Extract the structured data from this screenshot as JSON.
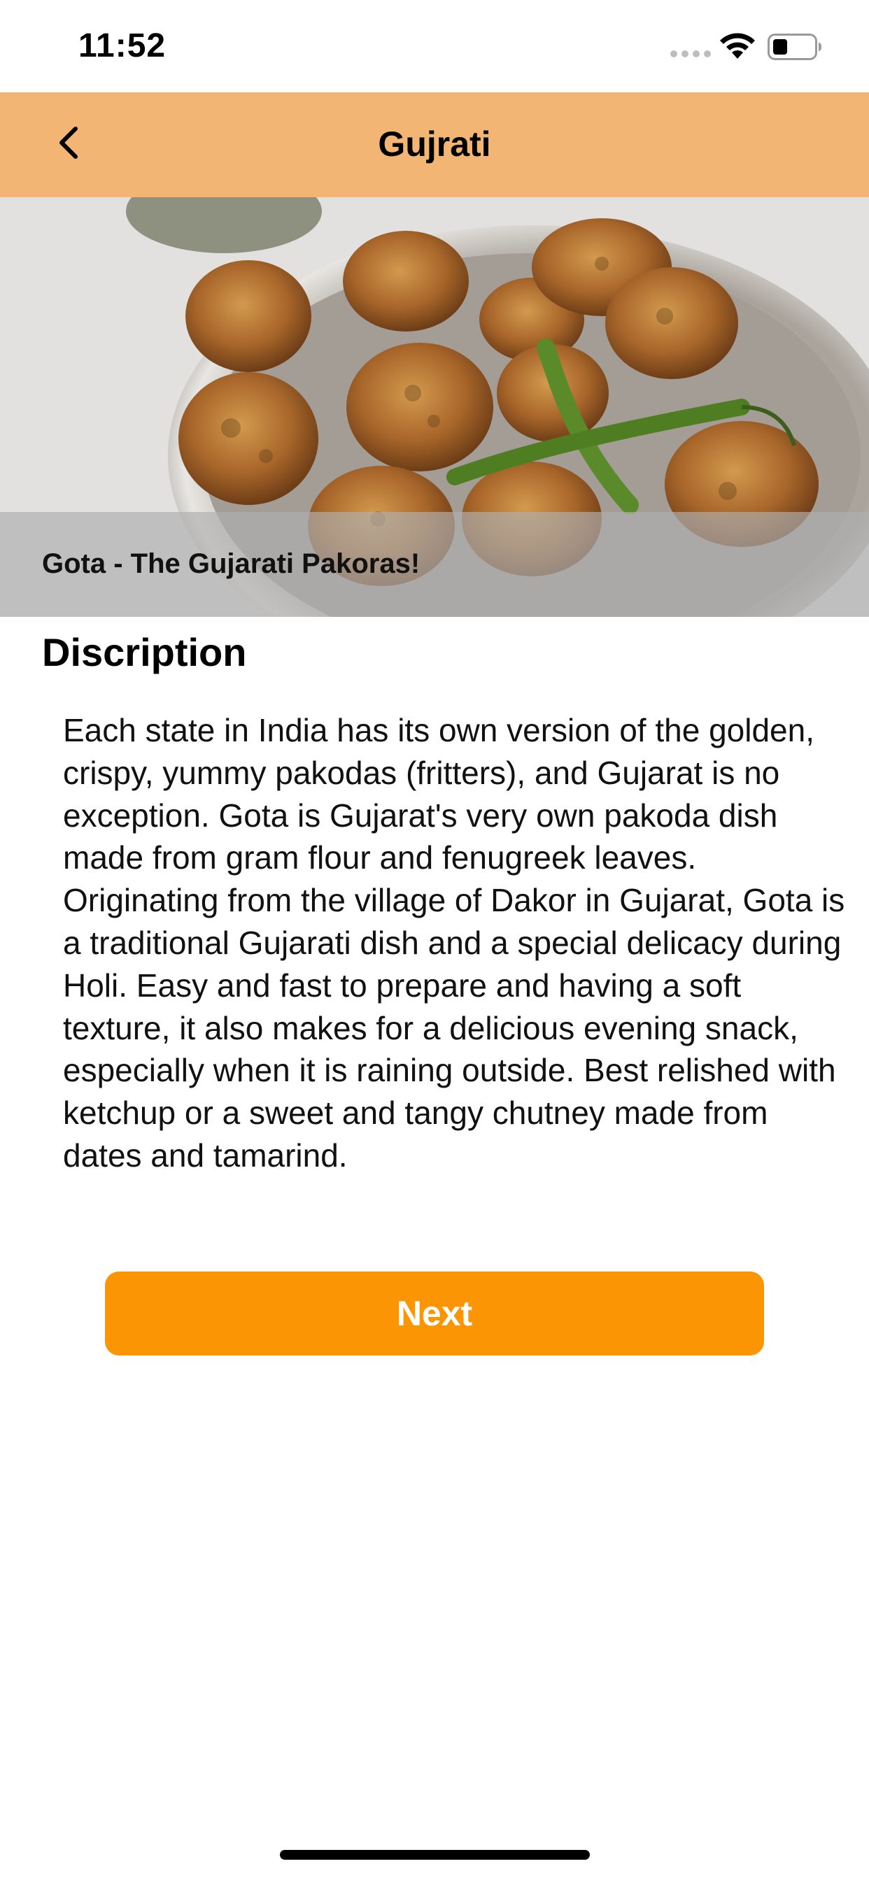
{
  "status_bar": {
    "time": "11:52",
    "icons": [
      "signal-dots-icon",
      "wifi-icon",
      "battery-icon"
    ]
  },
  "nav": {
    "back_icon": "chevron-left-icon",
    "title": "Gujrati"
  },
  "hero": {
    "caption": "Gota - The Gujarati Pakoras!"
  },
  "content": {
    "section_title": "Discription",
    "description": "Each state in India has its own version of the golden, crispy, yummy pakodas (fritters), and Gujarat is no exception. Gota is Gujarat's very own pakoda dish made from gram flour and fenugreek leaves. Originating from the village of Dakor in Gujarat, Gota is a traditional Gujarati dish and a special delicacy during Holi. Easy and fast to prepare and having a soft texture, it also makes for a delicious evening snack, especially when it is raining outside. Best relished with ketchup or a sweet and tangy chutney made from dates and tamarind."
  },
  "actions": {
    "next_label": "Next"
  },
  "colors": {
    "nav_background": "#f2b573",
    "button_background": "#fc9503",
    "button_text": "#ffffff"
  }
}
